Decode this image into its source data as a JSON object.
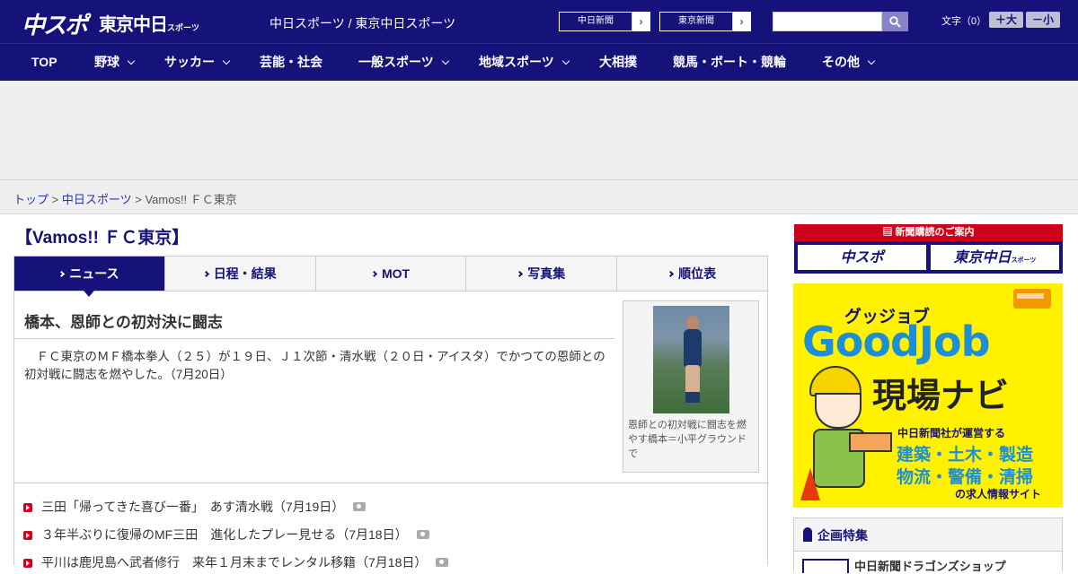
{
  "header": {
    "logo_main": "中スポ",
    "logo_tokyo": "東京中日",
    "logo_tokyo_small": "スポーツ",
    "site_title": "中日スポーツ / 東京中日スポーツ",
    "paper_links": [
      {
        "label": "中日新聞",
        "arrow": "›"
      },
      {
        "label": "東京新聞",
        "arrow": "›"
      }
    ],
    "search": {
      "placeholder": ""
    },
    "font_size_label": "文字（0）",
    "font_bigger": "＋大",
    "font_smaller": "－小"
  },
  "nav": {
    "items": [
      {
        "label": "TOP"
      },
      {
        "label": "野球"
      },
      {
        "label": "サッカー"
      },
      {
        "label": "芸能・社会"
      },
      {
        "label": "一般スポーツ"
      },
      {
        "label": "地域スポーツ"
      },
      {
        "label": "大相撲"
      },
      {
        "label": "競馬・ボート・競輪"
      },
      {
        "label": "その他"
      }
    ]
  },
  "breadcrumb": {
    "home": "トップ",
    "sep": ">",
    "section": "中日スポーツ",
    "current": "Vamos!! ＦＣ東京"
  },
  "main": {
    "heading": "【Vamos!! ＦＣ東京】",
    "tabs": [
      {
        "label": "ニュース",
        "active": true
      },
      {
        "label": "日程・結果"
      },
      {
        "label": "MOT"
      },
      {
        "label": "写真集"
      },
      {
        "label": "順位表"
      }
    ],
    "article": {
      "title": "橋本、恩師との初対決に闘志",
      "body": "　ＦＣ東京のＭＦ橋本拳人（２５）が１９日、Ｊ１次節・清水戦（２０日・アイスタ）でかつての恩師との初対戦に闘志を燃やした。（7月20日）",
      "photo_caption": "恩師との初対戦に闘志を燃やす橋本＝小平グラウンドで"
    },
    "news": [
      {
        "title": "三田「帰ってきた喜び一番」　あす清水戦（7月19日）",
        "photo": true
      },
      {
        "title": "３年半ぶりに復帰のMF三田　進化したプレー見せる（7月18日）",
        "photo": true
      },
      {
        "title": "平川は鹿児島へ武者修行　来年１月末までレンタル移籍（7月18日）",
        "photo": true
      }
    ]
  },
  "sidebar": {
    "subscribe": {
      "head": "新聞購読のご案内",
      "btn1": "中スポ",
      "btn2": "東京中日",
      "btn2_small": "スポーツ"
    },
    "goodjob": {
      "kana": "グッジョブ",
      "main": "GoodJob",
      "sub": "現場ナビ",
      "line1": "中日新聞社が運営する",
      "line2": "建築・土木・製造",
      "line3": "物流・警備・清掃",
      "line4": "の求人情報サイト"
    },
    "feature": {
      "head": "企画特集",
      "item": "中日新聞ドラゴンズショップ"
    }
  },
  "colors": {
    "brand_navy": "#15127a",
    "accent_red": "#d0021b",
    "link_blue": "#2433b3",
    "goodjob_yellow": "#fff100"
  }
}
